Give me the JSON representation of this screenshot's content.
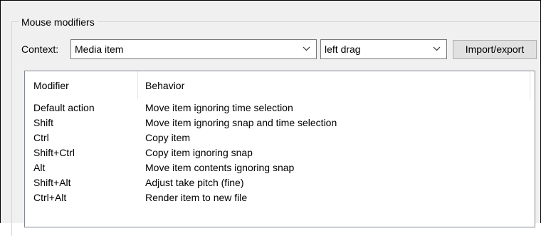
{
  "group": {
    "title": "Mouse modifiers"
  },
  "context": {
    "label": "Context:",
    "selected": "Media item",
    "action_selected": "left drag",
    "import_export_label": "Import/export"
  },
  "list": {
    "columns": [
      "Modifier",
      "Behavior"
    ],
    "rows": [
      {
        "modifier": "Default action",
        "behavior": "Move item ignoring time selection"
      },
      {
        "modifier": "Shift",
        "behavior": "Move item ignoring snap and time selection"
      },
      {
        "modifier": "Ctrl",
        "behavior": "Copy item"
      },
      {
        "modifier": "Shift+Ctrl",
        "behavior": "Copy item ignoring snap"
      },
      {
        "modifier": "Alt",
        "behavior": "Move item contents ignoring snap"
      },
      {
        "modifier": "Shift+Alt",
        "behavior": "Adjust take pitch (fine)"
      },
      {
        "modifier": "Ctrl+Alt",
        "behavior": "Render item to new file"
      }
    ]
  }
}
